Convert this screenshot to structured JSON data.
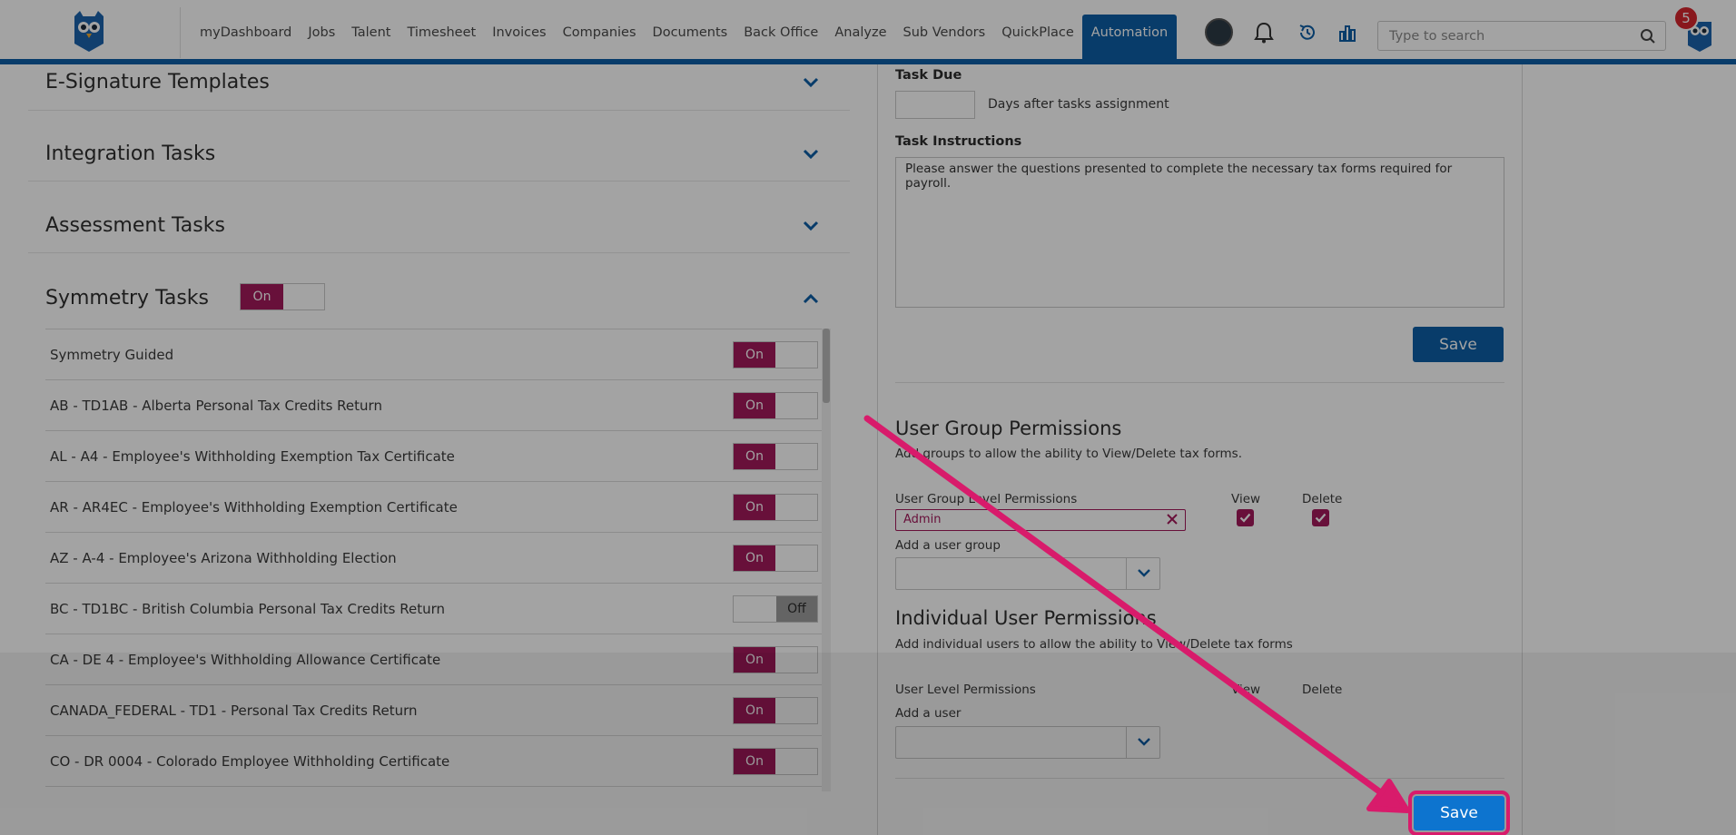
{
  "nav": {
    "items": [
      {
        "label": "myDashboard",
        "name": "nav-mydashboard"
      },
      {
        "label": "Jobs",
        "name": "nav-jobs"
      },
      {
        "label": "Talent",
        "name": "nav-talent"
      },
      {
        "label": "Timesheet",
        "name": "nav-timesheet"
      },
      {
        "label": "Invoices",
        "name": "nav-invoices"
      },
      {
        "label": "Companies",
        "name": "nav-companies"
      },
      {
        "label": "Documents",
        "name": "nav-documents"
      },
      {
        "label": "Back Office",
        "name": "nav-back-office"
      },
      {
        "label": "Analyze",
        "name": "nav-analyze"
      },
      {
        "label": "Sub Vendors",
        "name": "nav-sub-vendors"
      },
      {
        "label": "QuickPlace",
        "name": "nav-quickplace"
      },
      {
        "label": "Automation",
        "name": "nav-automation",
        "active": true
      }
    ],
    "search_placeholder": "Type to search",
    "notification_count": "5"
  },
  "left": {
    "sections": {
      "esignature": "E-Signature Templates",
      "integration": "Integration Tasks",
      "assessment": "Assessment Tasks",
      "symmetry": "Symmetry Tasks"
    },
    "symmetry_toggle": "On",
    "tasks": [
      {
        "label": "Symmetry Guided",
        "state": "On"
      },
      {
        "label": "AB - TD1AB - Alberta Personal Tax Credits Return",
        "state": "On"
      },
      {
        "label": "AL - A4 - Employee's Withholding Exemption Tax Certificate",
        "state": "On"
      },
      {
        "label": "AR - AR4EC - Employee's Withholding Exemption Certificate",
        "state": "On"
      },
      {
        "label": "AZ - A-4 - Employee's Arizona Withholding Election",
        "state": "On"
      },
      {
        "label": "BC - TD1BC - British Columbia Personal Tax Credits Return",
        "state": "Off"
      },
      {
        "label": "CA - DE 4 - Employee's Withholding Allowance Certificate",
        "state": "On"
      },
      {
        "label": "CANADA_FEDERAL - TD1 - Personal Tax Credits Return",
        "state": "On"
      },
      {
        "label": "CO - DR 0004 - Colorado Employee Withholding Certificate",
        "state": "On"
      }
    ]
  },
  "right": {
    "task_due_label": "Task Due",
    "task_due_value": "",
    "days_after": "Days after tasks assignment",
    "instructions_label": "Task Instructions",
    "instructions_value": "Please answer the questions presented to complete the necessary tax forms required for payroll.",
    "save_label": "Save",
    "ug_heading": "User Group Permissions",
    "ug_desc": "Add groups to allow the ability to View/Delete tax forms.",
    "ug_level_label": "User Group Level Permissions",
    "view_label": "View",
    "delete_label": "Delete",
    "ug_chip": "Admin",
    "add_group_label": "Add a user group",
    "iu_heading": "Individual User Permissions",
    "iu_desc": "Add individual users to allow the ability to View/Delete tax forms",
    "iu_level_label": "User Level Permissions",
    "add_user_label": "Add a user",
    "bottom_save_label": "Save"
  },
  "colors": {
    "brand_blue": "#0d5ea6",
    "toggle_on": "#a3195b",
    "annotation_arrow": "#d81b6b"
  }
}
